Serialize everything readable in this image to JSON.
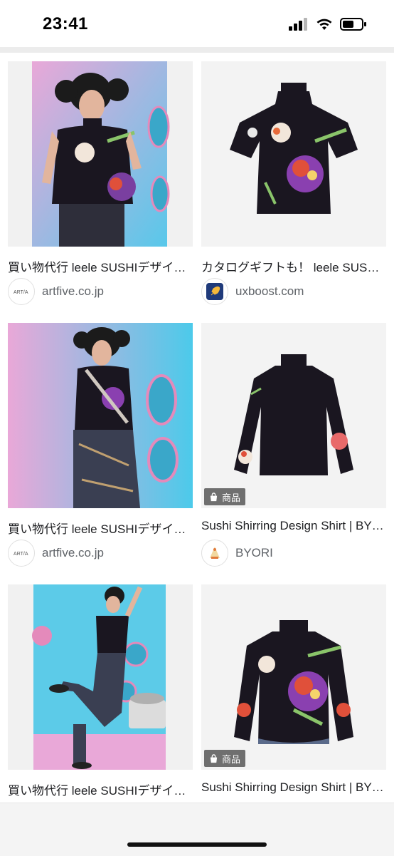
{
  "status_bar": {
    "time": "23:41"
  },
  "results": [
    {
      "caption": "買い物代行 leele SUSHIデザイ…",
      "source": "artfive.co.jp",
      "source_icon": "artfive-logo",
      "badge": ""
    },
    {
      "caption": "カタログギフトも！ leele SUS…",
      "source": "uxboost.com",
      "source_icon": "rocket-icon",
      "badge": ""
    },
    {
      "caption": "買い物代行 leele SUSHIデザイ…",
      "source": "artfive.co.jp",
      "source_icon": "artfive-logo",
      "badge": ""
    },
    {
      "caption": "Sushi Shirring Design Shirt | BY…",
      "source": "BYORI",
      "source_icon": "byori-logo",
      "badge": "商品"
    },
    {
      "caption": "買い物代行 leele SUSHIデザイ…",
      "source": "",
      "source_icon": "artfive-logo",
      "badge": ""
    },
    {
      "caption": "Sushi Shirring Design Shirt | BY…",
      "source": "",
      "source_icon": "byori-logo",
      "badge": "商品"
    }
  ],
  "colors": {
    "shirt": "#1a1620",
    "backdrop_pink": "#e6b8d8",
    "backdrop_blue": "#40c4e6"
  }
}
